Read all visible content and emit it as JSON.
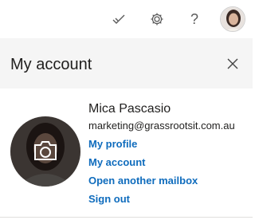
{
  "topbar": {
    "icons": [
      "premium-check-icon",
      "gear-icon",
      "help-icon"
    ],
    "help_label": "?",
    "avatar": "profile-avatar"
  },
  "panel": {
    "title": "My account",
    "close_icon": "close-icon"
  },
  "user": {
    "name": "Mica Pascasio",
    "email": "marketing@grassrootsit.com.au"
  },
  "links": {
    "my_profile": "My profile",
    "my_account": "My account",
    "open_mailbox": "Open another mailbox",
    "sign_out": "Sign out"
  },
  "colors": {
    "link": "#0f6cbd",
    "header_bg": "#f5f5f5"
  }
}
